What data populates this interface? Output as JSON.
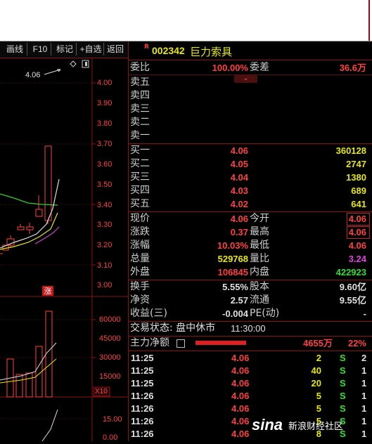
{
  "toolbar": {
    "buttons": [
      "画线",
      "F10",
      "标记",
      "+自选",
      "返回"
    ]
  },
  "price_chart": {
    "price_axis": [
      "4.00",
      "3.90",
      "3.80",
      "3.70",
      "3.60",
      "3.50",
      "3.40",
      "3.30",
      "3.20",
      "3.10",
      "3.00"
    ],
    "high_annotation": "4.06",
    "limit_tag": "涨",
    "volume_axis": [
      "60000",
      "45000",
      "30000",
      "15000"
    ],
    "volume_unit": "X10",
    "indicator_axis": [
      "15.00",
      "0.00"
    ]
  },
  "stock": {
    "flag": "R",
    "code": "002342",
    "name": "巨力索具"
  },
  "order_ratio": {
    "wb_label": "委比",
    "wb_value": "100.00%",
    "wc_label": "委差",
    "wc_value": "36.6万"
  },
  "asks": [
    {
      "label": "卖五",
      "price": "",
      "vol": ""
    },
    {
      "label": "卖四",
      "price": "",
      "vol": ""
    },
    {
      "label": "卖三",
      "price": "",
      "vol": ""
    },
    {
      "label": "卖二",
      "price": "",
      "vol": ""
    },
    {
      "label": "卖一",
      "price": "",
      "vol": ""
    }
  ],
  "bids": [
    {
      "label": "买一",
      "price": "4.06",
      "vol": "360128"
    },
    {
      "label": "买二",
      "price": "4.05",
      "vol": "2747"
    },
    {
      "label": "买三",
      "price": "4.04",
      "vol": "1380"
    },
    {
      "label": "买四",
      "price": "4.03",
      "vol": "689"
    },
    {
      "label": "买五",
      "price": "4.02",
      "vol": "641"
    }
  ],
  "stats": [
    {
      "l1": "现价",
      "v1": "4.06",
      "l2": "今开",
      "v2": "4.06"
    },
    {
      "l1": "涨跌",
      "v1": "0.37",
      "l2": "最高",
      "v2": "4.06"
    },
    {
      "l1": "涨幅",
      "v1": "10.03%",
      "l2": "最低",
      "v2": "4.06"
    },
    {
      "l1": "总量",
      "v1": "529768",
      "l2": "量比",
      "v2": "3.24"
    },
    {
      "l1": "外盘",
      "v1": "106845",
      "l2": "内盘",
      "v2": "422923"
    }
  ],
  "fund": [
    {
      "l1": "换手",
      "v1": "5.55%",
      "l2": "股本",
      "v2": "9.60亿"
    },
    {
      "l1": "净资",
      "v1": "2.57",
      "l2": "流通",
      "v2": "9.55亿"
    },
    {
      "l1": "收益(三)",
      "v1": "-0.004",
      "l2": "PE(动)",
      "v2": "-"
    }
  ],
  "status": {
    "label": "交易状态: 盘中休市",
    "time": "11:30:00"
  },
  "main_force": {
    "label": "主力净额",
    "amount": "4655万",
    "pct": "22%",
    "bar_fill": 0.65
  },
  "ticks": [
    {
      "t": "11:25",
      "p": "4.06",
      "v": "2",
      "d": "S",
      "n": "2"
    },
    {
      "t": "11:25",
      "p": "4.06",
      "v": "40",
      "d": "S",
      "n": "1"
    },
    {
      "t": "11:25",
      "p": "4.06",
      "v": "20",
      "d": "S",
      "n": "1"
    },
    {
      "t": "11:26",
      "p": "4.06",
      "v": "5",
      "d": "S",
      "n": "1"
    },
    {
      "t": "11:26",
      "p": "4.06",
      "v": "5",
      "d": "S",
      "n": "1"
    },
    {
      "t": "11:26",
      "p": "4.06",
      "v": "5",
      "d": "S",
      "n": "1"
    },
    {
      "t": "11:26",
      "p": "4.06",
      "v": "8",
      "d": "S",
      "n": "1"
    }
  ],
  "watermark": {
    "logo": "sina",
    "text": "新浪财经社区"
  },
  "colors": {
    "up": "#ff4040",
    "down": "#30e030",
    "border": "#8c1010",
    "volume": "#e8e800"
  }
}
